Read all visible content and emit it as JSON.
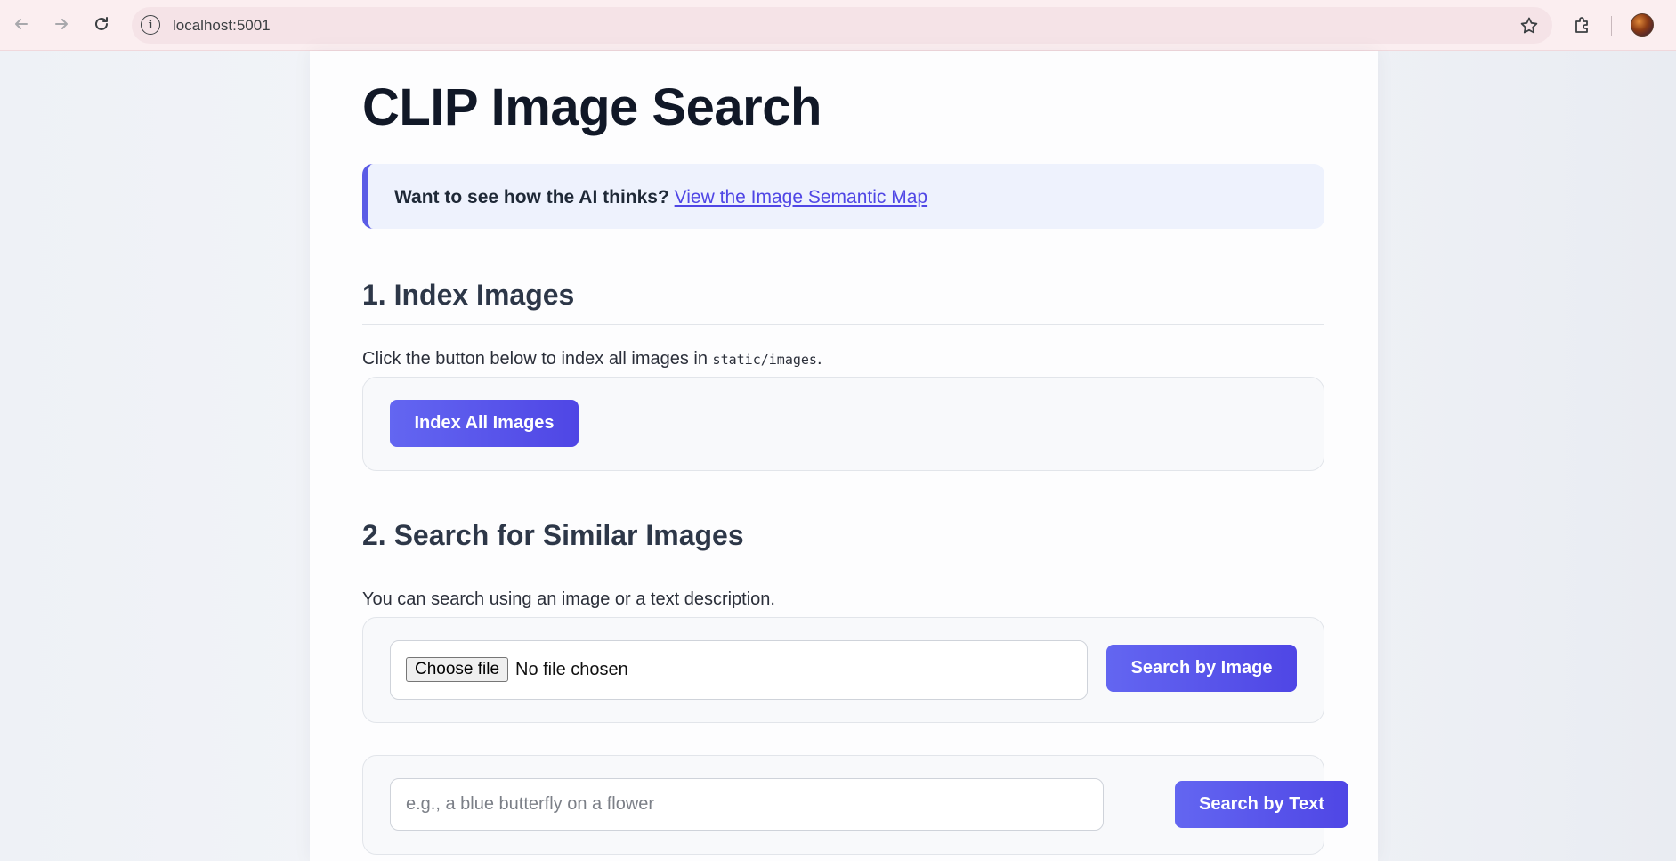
{
  "browser": {
    "url": "localhost:5001"
  },
  "page": {
    "title": "CLIP Image Search",
    "banner": {
      "lead": "Want to see how the AI thinks?",
      "link_label": "View the Image Semantic Map"
    }
  },
  "index_section": {
    "heading": "1. Index Images",
    "description_prefix": "Click the button below to index all images in ",
    "description_path": "static/images",
    "description_suffix": ".",
    "button_label": "Index All Images"
  },
  "search_section": {
    "heading": "2. Search for Similar Images",
    "description": "You can search using an image or a text description.",
    "image_search": {
      "choose_file_label": "Choose file",
      "file_status": "No file chosen",
      "button_label": "Search by Image"
    },
    "text_search": {
      "placeholder": "e.g., a blue butterfly on a flower",
      "value": "",
      "button_label": "Search by Text"
    }
  },
  "icons": [
    "back-arrow-icon",
    "forward-arrow-icon",
    "reload-icon",
    "site-info-icon",
    "star-icon",
    "extensions-icon"
  ],
  "colors": {
    "accent": "#4f46e5",
    "accent_light": "#6366f1",
    "banner_bg": "#eef2fd",
    "title": "#111827"
  }
}
